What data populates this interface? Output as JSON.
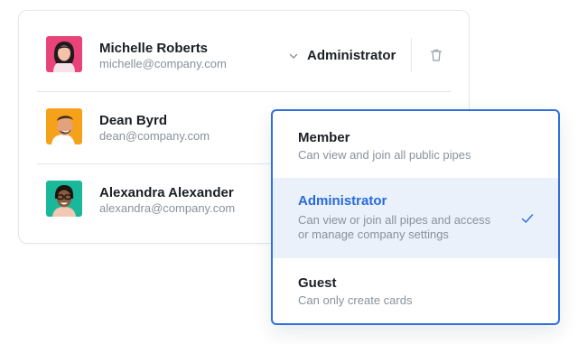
{
  "members": [
    {
      "name": "Michelle Roberts",
      "email": "michelle@company.com",
      "role": "Administrator",
      "avatar_colors": {
        "bg": "#e8447a",
        "skin": "#f3c2a8",
        "hair": "#221a1e",
        "shirt": "#f6e3ea"
      }
    },
    {
      "name": "Dean Byrd",
      "email": "dean@company.com",
      "avatar_colors": {
        "bg": "#f6a11a",
        "skin": "#e2a27e",
        "hair": "#3a2a22",
        "shirt": "#ffffff"
      }
    },
    {
      "name": "Alexandra Alexander",
      "email": "alexandra@company.com",
      "avatar_colors": {
        "bg": "#1ab89a",
        "skin": "#8a5a3d",
        "hair": "#1c140f",
        "shirt": "#f2c8b2"
      }
    }
  ],
  "role_options": [
    {
      "title": "Member",
      "description": "Can view and join all public pipes",
      "selected": false
    },
    {
      "title": "Administrator",
      "description": "Can view or join all pipes and access or manage company settings",
      "selected": true
    },
    {
      "title": "Guest",
      "description": "Can only create cards",
      "selected": false
    }
  ],
  "icons": {
    "role_chevron": "chevron-down-icon",
    "delete": "trash-icon",
    "selected": "check-icon"
  },
  "colors": {
    "accent": "#2f6fe0",
    "selected_bg": "#eaf1fb",
    "text_primary": "#1b1f24",
    "text_secondary": "#8a919b"
  }
}
